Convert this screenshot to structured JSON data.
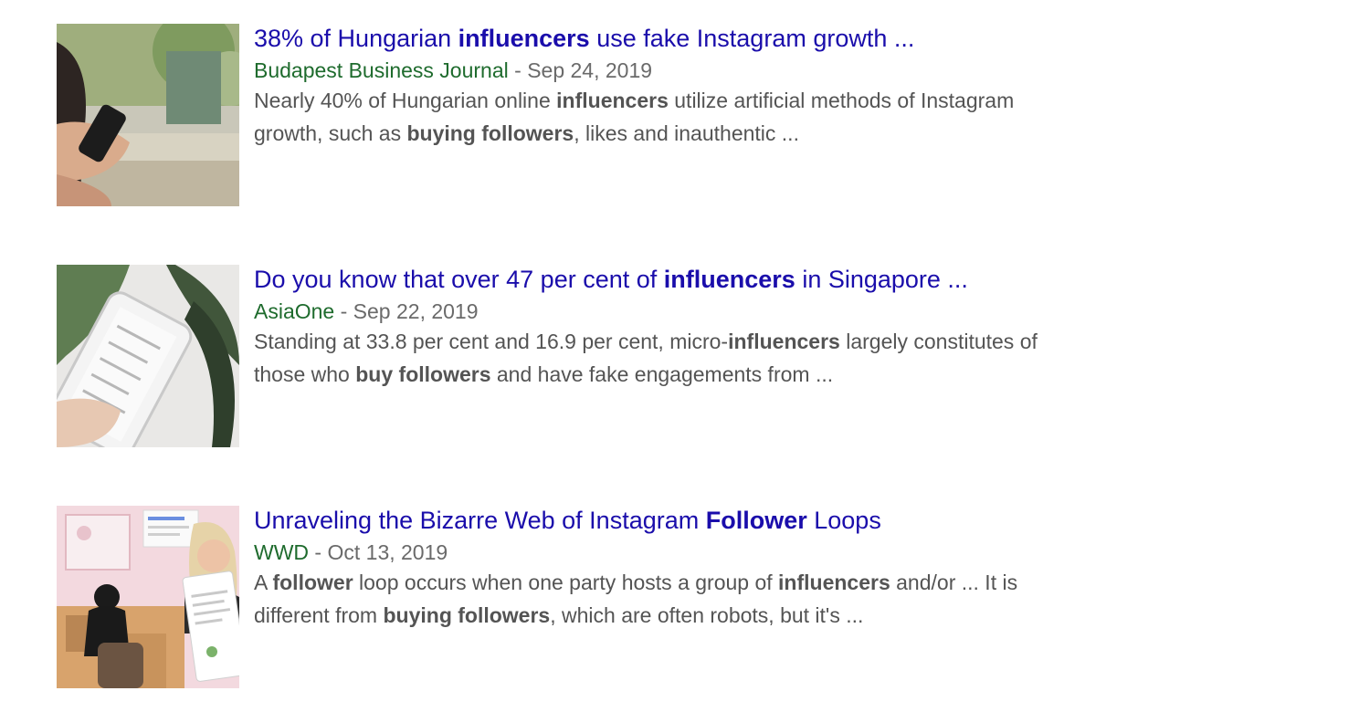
{
  "results": [
    {
      "title": {
        "a": "38% of Hungarian ",
        "b": "influencers",
        "c": " use fake Instagram growth ..."
      },
      "source": "Budapest Business Journal",
      "separator": " - ",
      "date": "Sep 24, 2019",
      "snippet": [
        "Nearly 40% of Hungarian online ",
        "influencers",
        " utilize artificial methods of Instagram",
        "growth, such as ",
        "buying followers",
        ", likes and inauthentic ..."
      ],
      "thumbnail_icon": "phone-in-hand-outdoor-image"
    },
    {
      "title": {
        "a": "Do you know that over 47 per cent of ",
        "b": "influencers",
        "c": " in Singapore ..."
      },
      "source": "AsiaOne",
      "separator": " - ",
      "date": "Sep 22, 2019",
      "snippet": [
        "Standing at 33.8 per cent and 16.9 per cent, micro-",
        "influencers",
        " largely constitutes of",
        "those who ",
        "buy followers",
        " and have fake engagements from ..."
      ],
      "thumbnail_icon": "smartphone-with-leaf-image"
    },
    {
      "title": {
        "a": "Unraveling the Bizarre Web of Instagram ",
        "b": "Follower",
        "c": " Loops"
      },
      "source": "WWD",
      "separator": " - ",
      "date": "Oct 13, 2019",
      "snippet": [
        "A ",
        "follower",
        " loop occurs when one party hosts a group of ",
        "influencers",
        " and/or ... It is",
        "different from ",
        "buying followers",
        ", which are often robots, but it's ..."
      ],
      "thumbnail_icon": "influencer-collage-image"
    }
  ],
  "colors": {
    "title": "#1a0dab",
    "source": "#1e6b2d",
    "meta": "#6a6a6a",
    "snippet": "#545454"
  }
}
